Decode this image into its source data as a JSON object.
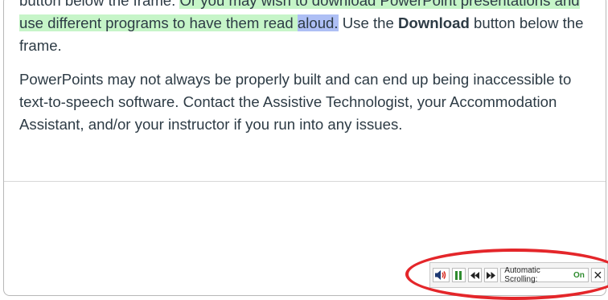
{
  "paragraph1": {
    "line0_pre": "button below the frame. ",
    "line0_hl": "Or you may wish to download PowerPoint presentations and",
    "line1_hl": "use different programs to have them read ",
    "line1_word": "aloud.",
    "line1_post_a": " Use the ",
    "line1_bold": "Download",
    "line1_post_b": " button below the",
    "line2": "frame."
  },
  "paragraph2": {
    "line0": "PowerPoints may not always be properly built and can end up being inaccessible to",
    "line1": "text-to-speech software. Contact the Assistive Technologist, your Accommodation",
    "line2": "Assistant, and/or your instructor if you run into any issues."
  },
  "tts_toolbar": {
    "volume_icon": "speaker-icon",
    "pause_icon": "pause-icon",
    "rewind_icon": "rewind-icon",
    "forward_icon": "fast-forward-icon",
    "scroll_label": "Automatic Scrolling:",
    "scroll_state": "On",
    "close_icon": "close-icon"
  },
  "colors": {
    "highlight_sentence": "#c6f5c8",
    "highlight_word": "#aebff5",
    "pause_icon": "#2e8b2e",
    "volume_icon_red": "#d9342b",
    "annotation_ellipse": "#e4262a"
  }
}
